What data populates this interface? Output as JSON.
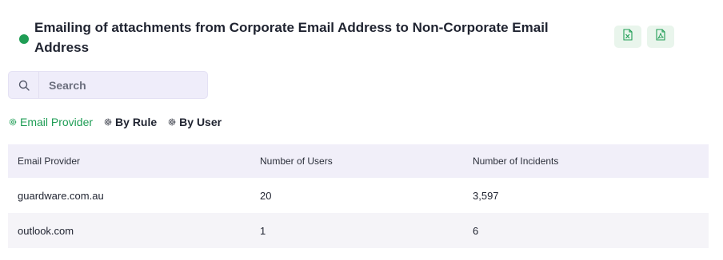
{
  "page": {
    "title": "Emailing of attachments from Corporate Email Address to Non-Corporate Email Address"
  },
  "export": {
    "excel_icon": "excel-file-icon",
    "pdf_icon": "pdf-file-icon",
    "icon_color": "#1f9d55",
    "bg_color": "#e9f5ec"
  },
  "search": {
    "placeholder": "Search",
    "value": ""
  },
  "tabs": [
    {
      "label": "Email Provider",
      "active": true
    },
    {
      "label": "By Rule",
      "active": false
    },
    {
      "label": "By User",
      "active": false
    }
  ],
  "table": {
    "columns": [
      "Email Provider",
      "Number of Users",
      "Number of Incidents"
    ],
    "rows": [
      [
        "guardware.com.au",
        "20",
        "3,597"
      ],
      [
        "outlook.com",
        "1",
        "6"
      ]
    ]
  },
  "colors": {
    "accent": "#1f9d55",
    "header_bg": "#f1eff9",
    "search_bg": "#efedfa"
  }
}
